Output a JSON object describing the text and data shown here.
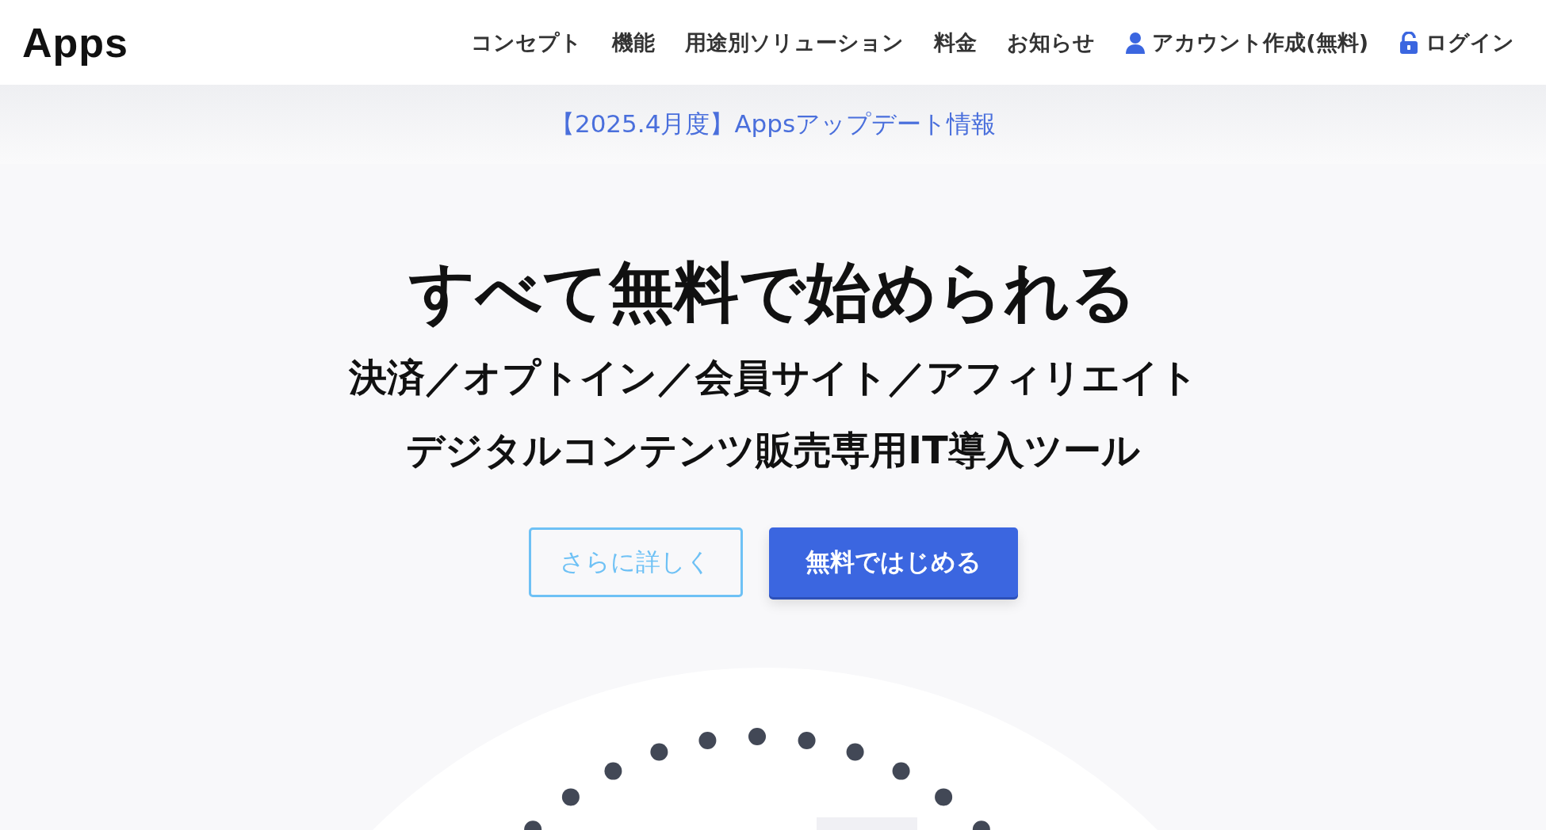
{
  "header": {
    "logo": "Apps",
    "nav": [
      {
        "label": "コンセプト",
        "kind": "text"
      },
      {
        "label": "機能",
        "kind": "text"
      },
      {
        "label": "用途別ソリューション",
        "kind": "text"
      },
      {
        "label": "料金",
        "kind": "text"
      },
      {
        "label": "お知らせ",
        "kind": "text"
      },
      {
        "label": "アカウント作成(無料)",
        "kind": "account"
      },
      {
        "label": "ログイン",
        "kind": "login"
      }
    ]
  },
  "banner": {
    "link": "【2025.4月度】Appsアップデート情報"
  },
  "hero": {
    "title": "すべて無料で始められる",
    "subtitle_lines": [
      "決済／オプトイン／会員サイト／アフィリエイト",
      "デジタルコンテンツ販売専用IT導入ツール"
    ],
    "buttons": [
      {
        "label": "さらに詳しく",
        "kind": "outline"
      },
      {
        "label": "無料ではじめる",
        "kind": "primary"
      }
    ]
  }
}
